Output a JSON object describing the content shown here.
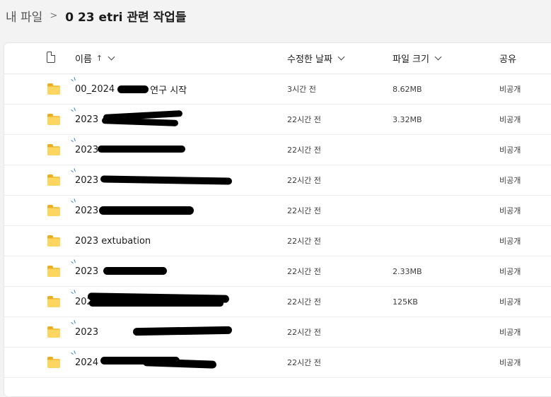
{
  "breadcrumb": {
    "root": "내 파일",
    "separator": ">",
    "current": "0 23 etri 관련 작업들"
  },
  "header": {
    "file_type_icon": "document-icon",
    "name_label": "이름",
    "name_sort_indicator": "↑",
    "modified_label": "수정한 날짜",
    "size_label": "파일 크기",
    "sharing_label": "공유"
  },
  "colors": {
    "background": "#f3f3f3",
    "panel": "#ffffff",
    "folder": "#f7c544",
    "sync_mark": "#3a7bd5"
  },
  "rows": [
    {
      "icon": "folder-icon",
      "name": "00_2024",
      "name_tail": "연구 시작",
      "modified": "3시간 전",
      "size": "8.62MB",
      "sharing": "비공개"
    },
    {
      "icon": "folder-icon",
      "name": "2023",
      "name_tail": "",
      "modified": "22시간 전",
      "size": "3.32MB",
      "sharing": "비공개"
    },
    {
      "icon": "folder-icon",
      "name": "2023",
      "name_tail": "",
      "modified": "22시간 전",
      "size": "",
      "sharing": "비공개"
    },
    {
      "icon": "folder-icon",
      "name": "2023",
      "name_tail": "",
      "modified": "22시간 전",
      "size": "",
      "sharing": "비공개"
    },
    {
      "icon": "folder-icon",
      "name": "2023",
      "name_tail": "",
      "modified": "22시간 전",
      "size": "",
      "sharing": "비공개"
    },
    {
      "icon": "folder-icon",
      "name": "2023 extubation",
      "name_tail": "",
      "modified": "22시간 전",
      "size": "",
      "sharing": "비공개"
    },
    {
      "icon": "folder-icon",
      "name": "2023",
      "name_tail": "",
      "modified": "22시간 전",
      "size": "2.33MB",
      "sharing": "비공개"
    },
    {
      "icon": "folder-icon",
      "name": "2023",
      "name_tail": "",
      "modified": "22시간 전",
      "size": "125KB",
      "sharing": "비공개"
    },
    {
      "icon": "folder-icon",
      "name": "2023",
      "name_tail": "",
      "modified": "22시간 전",
      "size": "",
      "sharing": "비공개"
    },
    {
      "icon": "folder-icon",
      "name": "2024",
      "name_tail": "",
      "modified": "22시간 전",
      "size": "",
      "sharing": "비공개"
    }
  ]
}
